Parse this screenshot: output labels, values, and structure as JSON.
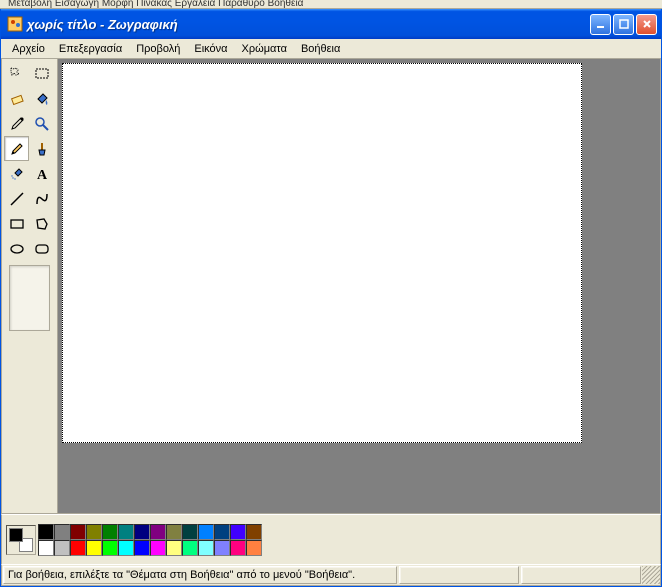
{
  "partial_background": "Μεταβολή   Εισαγωγή   Μορφή   Πίνακας   Εργαλεία   Παράθυρο   Βοήθεια",
  "titlebar": {
    "title": "χωρίς τίτλο - Ζωγραφική"
  },
  "menu": {
    "file": "Αρχείο",
    "edit": "Επεξεργασία",
    "view": "Προβολή",
    "image": "Εικόνα",
    "colors": "Χρώματα",
    "help": "Βοήθεια"
  },
  "tools": [
    "free-select",
    "rect-select",
    "eraser",
    "fill",
    "picker",
    "magnify",
    "pencil",
    "brush",
    "airbrush",
    "text",
    "line",
    "curve",
    "rectangle",
    "polygon",
    "ellipse",
    "rounded-rect"
  ],
  "selected_tool": "pencil",
  "palette_row1": [
    "#000000",
    "#808080",
    "#800000",
    "#808000",
    "#008000",
    "#008080",
    "#000080",
    "#800080",
    "#808040",
    "#004040",
    "#0080ff",
    "#004080",
    "#4000ff",
    "#804000"
  ],
  "palette_row2": [
    "#ffffff",
    "#c0c0c0",
    "#ff0000",
    "#ffff00",
    "#00ff00",
    "#00ffff",
    "#0000ff",
    "#ff00ff",
    "#ffff80",
    "#00ff80",
    "#80ffff",
    "#8080ff",
    "#ff0080",
    "#ff8040"
  ],
  "current": {
    "fg": "#000000",
    "bg": "#ffffff"
  },
  "status": {
    "text": "Για βοήθεια, επιλέξτε τα \"Θέματα στη Βοήθεια\" από το μενού \"Βοήθεια\"."
  }
}
